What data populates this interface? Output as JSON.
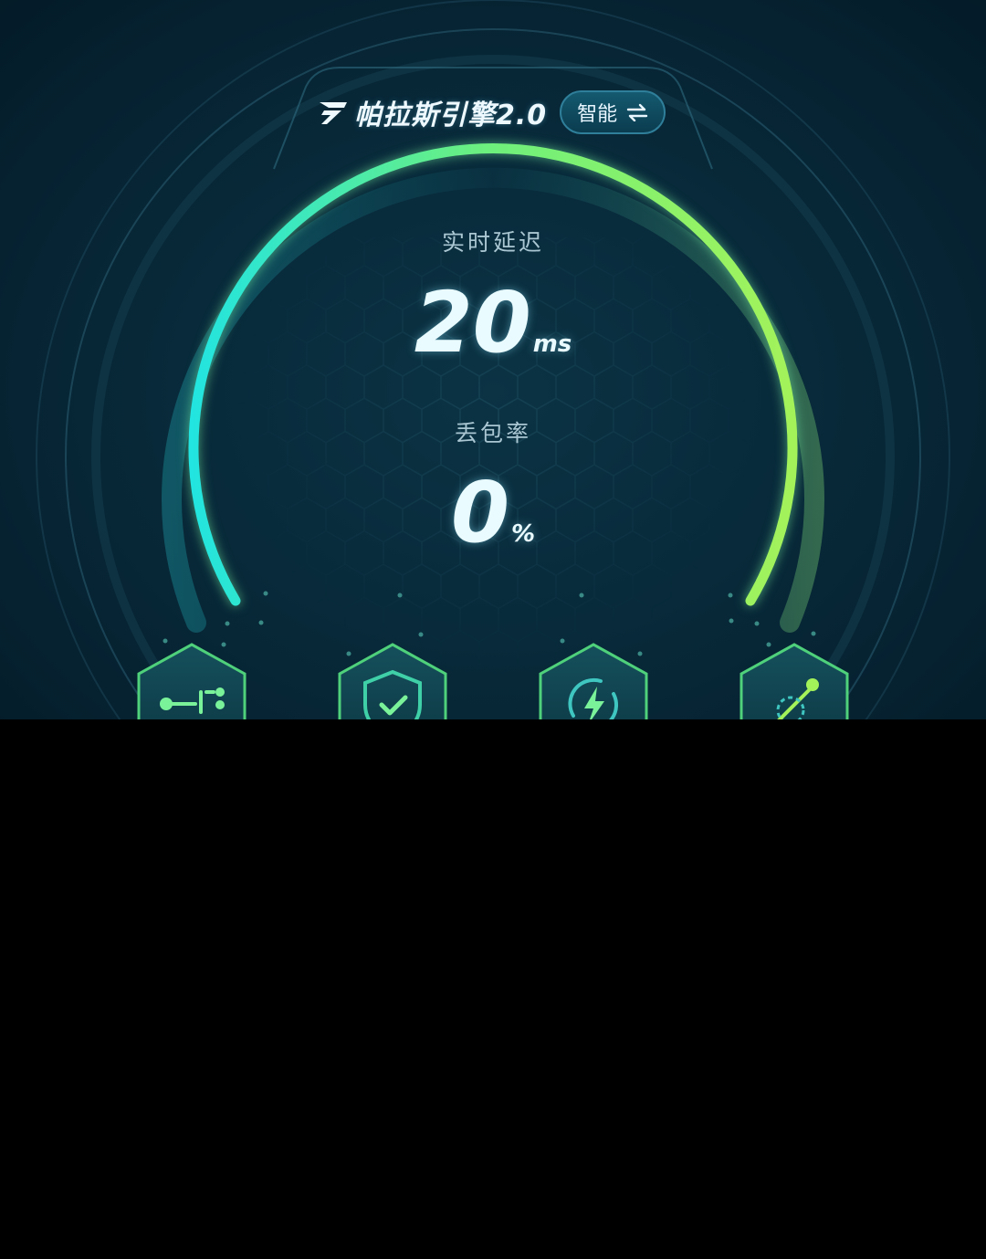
{
  "header": {
    "title": "帕拉斯引擎2.0",
    "mode_label": "智能",
    "logo_icon": "pallas-logo-icon",
    "switch_icon": "swap-arrows-icon"
  },
  "gauge": {
    "latency_label": "实时延迟",
    "latency_value": "20",
    "latency_unit": "ms",
    "loss_label": "丢包率",
    "loss_value": "0",
    "loss_unit": "%"
  },
  "features": [
    {
      "icon": "route-nodes-icon"
    },
    {
      "icon": "shield-check-icon"
    },
    {
      "icon": "lightning-boost-icon"
    },
    {
      "icon": "path-link-icon"
    }
  ],
  "colors": {
    "arc_start": "#22e4e0",
    "arc_end": "#a4f25a",
    "background": "#072637",
    "hex_border": "#4fd07a"
  }
}
